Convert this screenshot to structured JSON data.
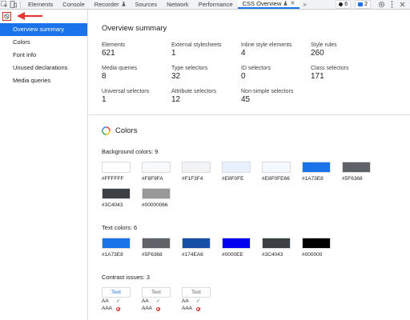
{
  "tabs": [
    {
      "label": "Elements",
      "active": false
    },
    {
      "label": "Console",
      "active": false
    },
    {
      "label": "Recorder",
      "active": false,
      "mini_icon": "flask-icon"
    },
    {
      "label": "Sources",
      "active": false
    },
    {
      "label": "Network",
      "active": false
    },
    {
      "label": "Performance",
      "active": false
    },
    {
      "label": "CSS Overview",
      "active": true,
      "mini_icon": "flask-icon"
    }
  ],
  "toolbar": {
    "more": "»",
    "errors_count": "6",
    "messages_count": "2"
  },
  "sidebar": {
    "items": [
      {
        "label": "Overview summary",
        "selected": true
      },
      {
        "label": "Colors",
        "selected": false
      },
      {
        "label": "Font info",
        "selected": false
      },
      {
        "label": "Unused declarations",
        "selected": false
      },
      {
        "label": "Media queries",
        "selected": false
      }
    ]
  },
  "overview": {
    "title": "Overview summary",
    "stats": [
      {
        "label": "Elements",
        "value": "621"
      },
      {
        "label": "External stylesheets",
        "value": "1"
      },
      {
        "label": "Inline style elements",
        "value": "4"
      },
      {
        "label": "Style rules",
        "value": "260"
      },
      {
        "label": "Media queries",
        "value": "8"
      },
      {
        "label": "Type selectors",
        "value": "32"
      },
      {
        "label": "ID selectors",
        "value": "0"
      },
      {
        "label": "Class selectors",
        "value": "171"
      },
      {
        "label": "Universal selectors",
        "value": "1"
      },
      {
        "label": "Attribute selectors",
        "value": "12"
      },
      {
        "label": "Non-simple selectors",
        "value": "45"
      }
    ]
  },
  "colors": {
    "title": "Colors",
    "background_title": "Background colors: 9",
    "background": [
      {
        "label": "#FFFFFF",
        "color": "#FFFFFF"
      },
      {
        "label": "#F8F9FA",
        "color": "#F8F9FA"
      },
      {
        "label": "#F1F3F4",
        "color": "#F1F3F4"
      },
      {
        "label": "#E8F0FE",
        "color": "#E8F0FE"
      },
      {
        "label": "#E8F0FE66",
        "color": "#E8F0FE66"
      },
      {
        "label": "#1A73E8",
        "color": "#1A73E8"
      },
      {
        "label": "#5F6368",
        "color": "#5F6368"
      },
      {
        "label": "#3C4043",
        "color": "#3C4043"
      },
      {
        "label": "#00000066",
        "color": "#00000066"
      }
    ],
    "text_title": "Text colors: 6",
    "text": [
      {
        "label": "#1A73E8",
        "color": "#1A73E8"
      },
      {
        "label": "#5F6368",
        "color": "#5F6368"
      },
      {
        "label": "#174EA6",
        "color": "#174EA6"
      },
      {
        "label": "#0000EE",
        "color": "#0000EE"
      },
      {
        "label": "#3C4043",
        "color": "#3C4043"
      },
      {
        "label": "#000000",
        "color": "#000000"
      }
    ],
    "contrast_title": "Contrast issues: 3",
    "contrast": [
      {
        "sample": "Text",
        "fg": "#1A73E8",
        "aa": "AA",
        "aaa": "AAA"
      },
      {
        "sample": "Text",
        "fg": "#5F6368",
        "aa": "AA",
        "aaa": "AAA"
      },
      {
        "sample": "Text",
        "fg": "#5F6368",
        "aa": "AA",
        "aaa": "AAA"
      }
    ]
  }
}
